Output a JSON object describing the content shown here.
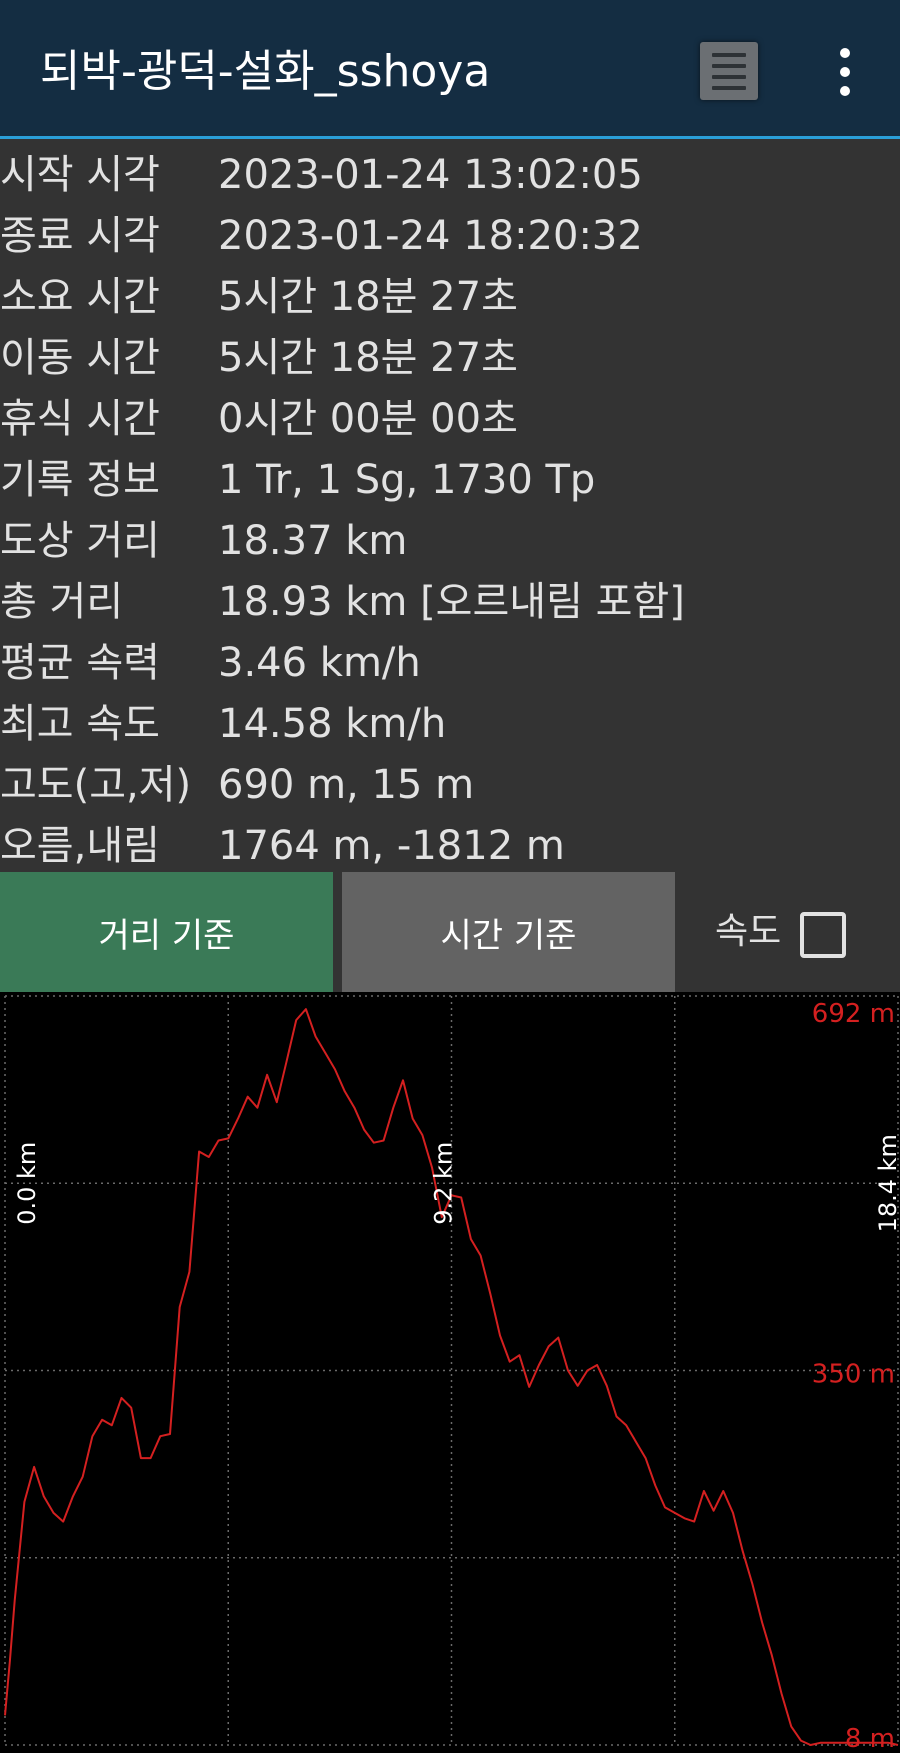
{
  "appbar": {
    "title": "되박-광덕-설화_sshoya",
    "list_icon": "list-icon",
    "more_icon": "more-vert-icon"
  },
  "stats": [
    {
      "label": "시작 시각",
      "value": "2023-01-24 13:02:05"
    },
    {
      "label": "종료 시각",
      "value": "2023-01-24 18:20:32"
    },
    {
      "label": "소요 시간",
      "value": "5시간 18분 27초"
    },
    {
      "label": "이동 시간",
      "value": "5시간 18분 27초"
    },
    {
      "label": "휴식 시간",
      "value": "0시간 00분 00초"
    },
    {
      "label": "기록 정보",
      "value": "1 Tr, 1 Sg, 1730 Tp"
    },
    {
      "label": "도상 거리",
      "value": "18.37 km"
    },
    {
      "label": "총 거리",
      "value": "18.93 km [오르내림 포함]"
    },
    {
      "label": "평균 속력",
      "value": "3.46 km/h"
    },
    {
      "label": "최고 속도",
      "value": "14.58 km/h"
    },
    {
      "label": "고도(고,저)",
      "value": "690 m, 15 m"
    },
    {
      "label": "오름,내림",
      "value": "1764 m, -1812 m"
    }
  ],
  "controls": {
    "distance_button": "거리 기준",
    "time_button": "시간 기준",
    "speed_label": "속도",
    "speed_checked": false,
    "active_color": "#3a7a57",
    "inactive_color": "#636363"
  },
  "chart_data": {
    "type": "line",
    "x_unit": "km",
    "y_unit": "m",
    "xlim": [
      0,
      18.4
    ],
    "ylim": [
      8,
      692
    ],
    "x_tick_labels": [
      "0.0 km",
      "9.2 km",
      "18.4 km"
    ],
    "y_tick_labels": [
      "692 m",
      "350 m",
      "8 m"
    ],
    "line_color": "#d42020",
    "grid": true,
    "x": [
      0.0,
      0.1,
      0.2,
      0.4,
      0.6,
      0.8,
      1.0,
      1.2,
      1.4,
      1.6,
      1.8,
      2.0,
      2.2,
      2.4,
      2.6,
      2.8,
      3.0,
      3.2,
      3.4,
      3.6,
      3.8,
      4.0,
      4.2,
      4.4,
      4.6,
      4.8,
      5.0,
      5.2,
      5.4,
      5.6,
      5.8,
      6.0,
      6.2,
      6.4,
      6.6,
      6.8,
      7.0,
      7.2,
      7.4,
      7.6,
      7.8,
      8.0,
      8.2,
      8.4,
      8.6,
      8.8,
      9.0,
      9.2,
      9.4,
      9.6,
      9.8,
      10.0,
      10.2,
      10.4,
      10.6,
      10.8,
      11.0,
      11.2,
      11.4,
      11.6,
      11.8,
      12.0,
      12.2,
      12.4,
      12.6,
      12.8,
      13.0,
      13.2,
      13.4,
      13.6,
      13.8,
      14.0,
      14.2,
      14.4,
      14.6,
      14.8,
      15.0,
      15.2,
      15.4,
      15.6,
      15.8,
      16.0,
      16.2,
      16.4,
      16.6,
      16.8,
      17.0,
      17.2,
      17.4,
      17.6,
      17.8,
      18.0,
      18.2,
      18.4
    ],
    "y": [
      35,
      85,
      140,
      230,
      262,
      235,
      220,
      212,
      235,
      253,
      290,
      305,
      300,
      325,
      316,
      270,
      270,
      290,
      292,
      408,
      440,
      550,
      545,
      560,
      562,
      580,
      600,
      590,
      620,
      595,
      632,
      670,
      680,
      655,
      640,
      625,
      605,
      590,
      570,
      558,
      560,
      590,
      615,
      580,
      565,
      535,
      490,
      510,
      508,
      470,
      455,
      420,
      382,
      358,
      364,
      335,
      355,
      372,
      380,
      350,
      336,
      350,
      355,
      336,
      308,
      300,
      285,
      270,
      245,
      225,
      220,
      215,
      212,
      240,
      222,
      240,
      220,
      185,
      155,
      120,
      90,
      55,
      25,
      12,
      8,
      10,
      10,
      10,
      10,
      10,
      10,
      10,
      10,
      8
    ]
  }
}
